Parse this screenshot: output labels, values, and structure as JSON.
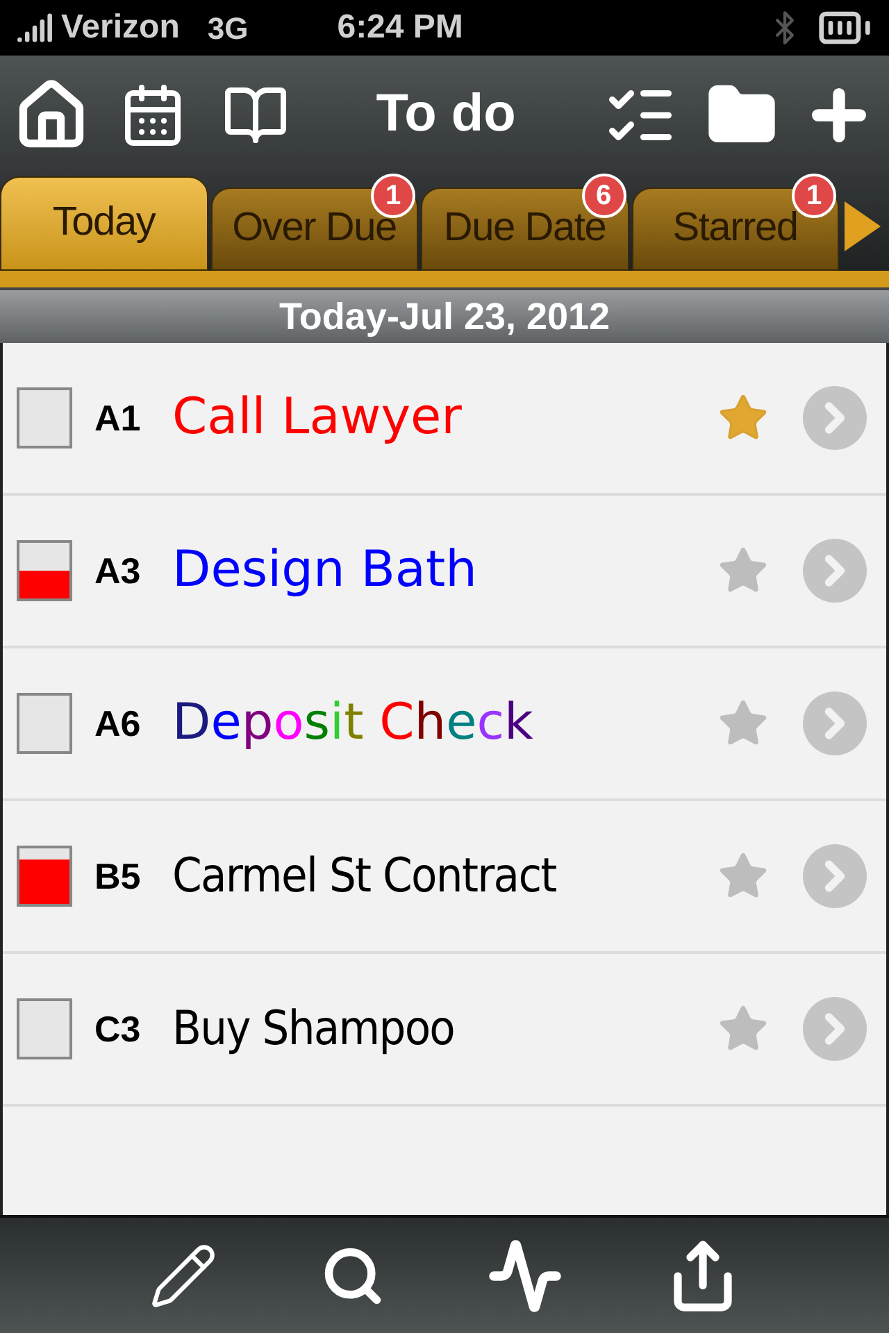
{
  "status_bar": {
    "carrier": "Verizon",
    "network": "3G",
    "time": "6:24 PM"
  },
  "toolbar": {
    "title": "To do"
  },
  "tabs": [
    {
      "label": "Today",
      "selected": true
    },
    {
      "label": "Over Due",
      "selected": false,
      "badge": "1"
    },
    {
      "label": "Due Date",
      "selected": false,
      "badge": "6"
    },
    {
      "label": "Starred",
      "selected": false,
      "badge": "1"
    }
  ],
  "section_header": "Today-Jul 23, 2012",
  "tasks": [
    {
      "priority": "A1",
      "kind": "ink",
      "progress": {
        "level": 0
      },
      "starred": true,
      "title": [
        {
          "text": "Call Lawyer",
          "color": "#ff0000"
        }
      ]
    },
    {
      "priority": "A3",
      "kind": "ink",
      "progress": {
        "level": 0.5
      },
      "starred": false,
      "title": [
        {
          "text": "Design Bath",
          "color": "#0000ff"
        }
      ]
    },
    {
      "priority": "A6",
      "kind": "ink",
      "progress": {
        "level": 0
      },
      "starred": false,
      "title": [
        {
          "text": "D",
          "color": "#1a1a80"
        },
        {
          "text": "e",
          "color": "#0000ff"
        },
        {
          "text": "p",
          "color": "#800080"
        },
        {
          "text": "o",
          "color": "#ff00ff"
        },
        {
          "text": "s",
          "color": "#008000"
        },
        {
          "text": "i",
          "color": "#33cc33"
        },
        {
          "text": "t ",
          "color": "#808000"
        },
        {
          "text": "C",
          "color": "#ff0000"
        },
        {
          "text": "h",
          "color": "#800000"
        },
        {
          "text": "e",
          "color": "#008080"
        },
        {
          "text": "c",
          "color": "#9933ff"
        },
        {
          "text": "k",
          "color": "#4b0082"
        }
      ]
    },
    {
      "priority": "B5",
      "kind": "typed",
      "progress": {
        "level": 0.8
      },
      "starred": false,
      "title": [
        {
          "text": "Carmel St Contract",
          "color": "#000000"
        }
      ]
    },
    {
      "priority": "C3",
      "kind": "typed",
      "progress": {
        "level": 0
      },
      "starred": false,
      "title": [
        {
          "text": "Buy Shampoo",
          "color": "#000000"
        }
      ]
    }
  ]
}
